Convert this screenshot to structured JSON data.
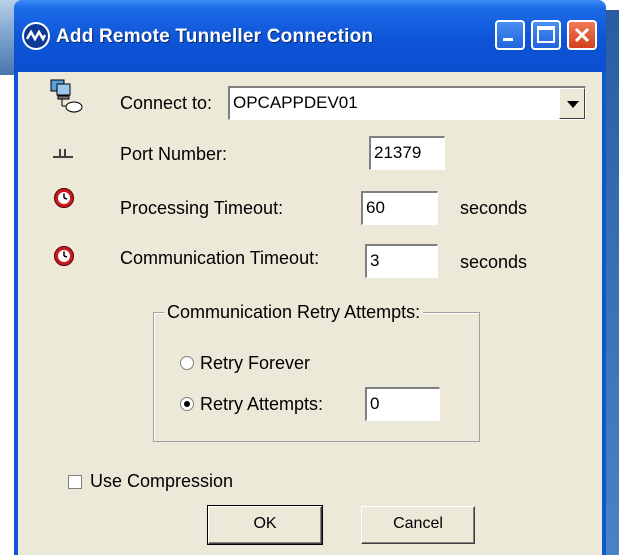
{
  "window": {
    "title": "Add Remote Tunneller Connection",
    "icon": "app-icon",
    "controls": [
      "minimize-icon",
      "maximize-icon",
      "close-icon"
    ]
  },
  "connect": {
    "label": "Connect to:",
    "value": "OPCAPPDEV01",
    "icon": "network-computers-icon"
  },
  "port": {
    "label": "Port Number:",
    "value": "21379",
    "icon": "port-icon"
  },
  "processing_timeout": {
    "label": "Processing Timeout:",
    "value": "60",
    "unit": "seconds",
    "icon": "clock-icon"
  },
  "communication_timeout": {
    "label": "Communication Timeout:",
    "value": "3",
    "unit": "seconds",
    "icon": "clock-icon"
  },
  "retry_group": {
    "title": "Communication Retry Attempts:",
    "forever_label": "Retry Forever",
    "attempts_label": "Retry Attempts:",
    "attempts_value": "0",
    "selected": "attempts"
  },
  "compression": {
    "label": "Use Compression",
    "checked": false
  },
  "buttons": {
    "ok": "OK",
    "cancel": "Cancel"
  },
  "colors": {
    "titlebar": "#0a4fd0",
    "dialog_bg": "#ece9d8",
    "close_button": "#d2401c"
  }
}
